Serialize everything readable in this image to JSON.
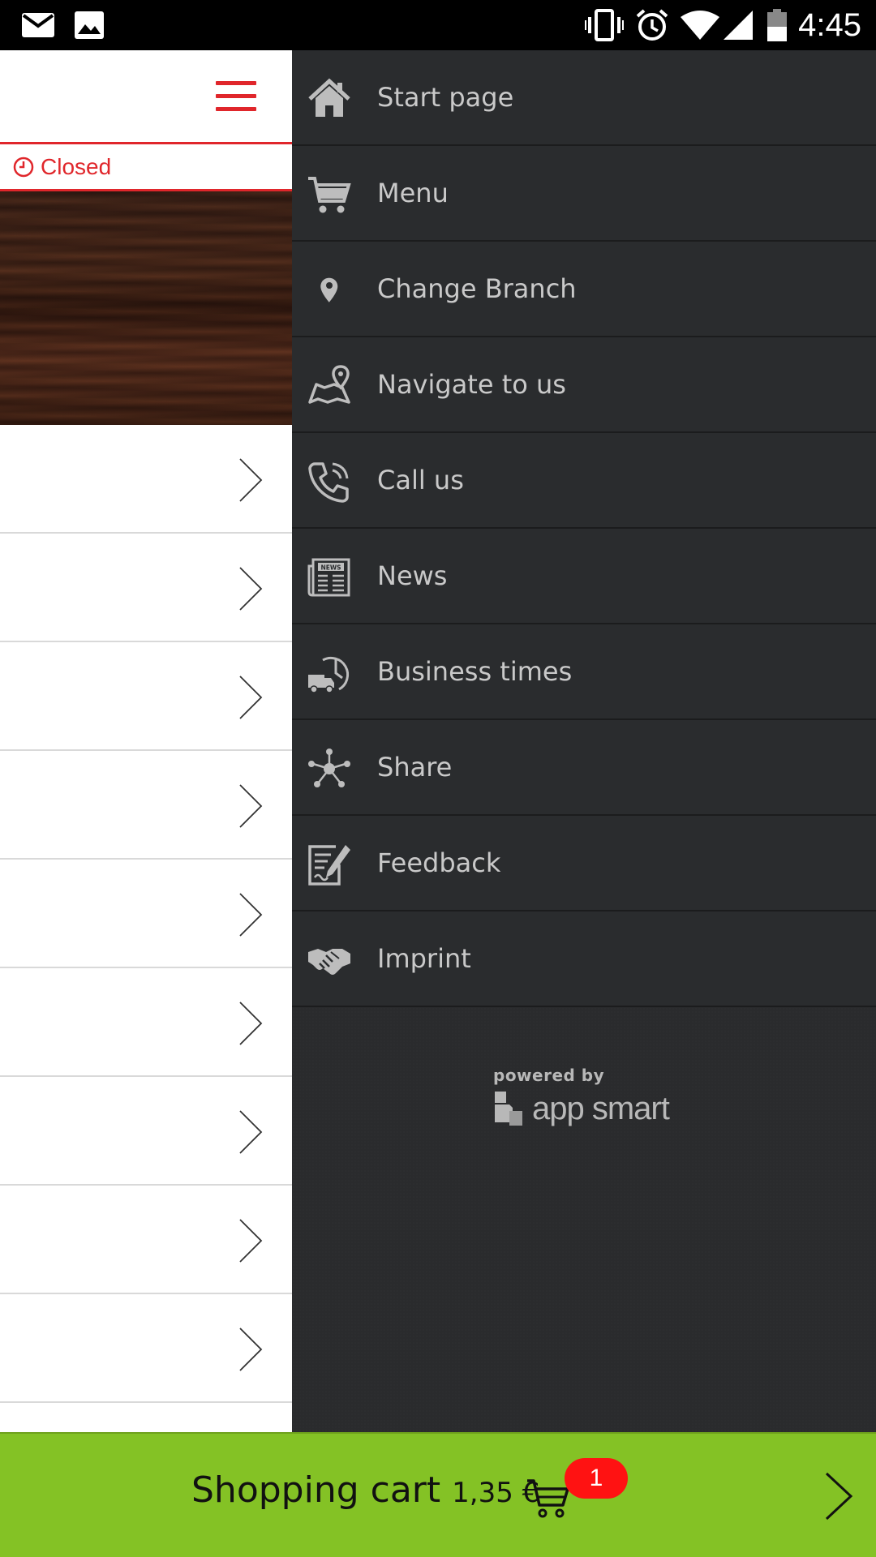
{
  "status_bar": {
    "time": "4:45",
    "icons": [
      "gmail-icon",
      "image-icon",
      "vibrate-icon",
      "alarm-icon",
      "wifi-icon",
      "signal-icon",
      "battery-icon"
    ]
  },
  "page": {
    "menu_icon": "hamburger-icon",
    "status_text": "Closed",
    "list_rows": 9
  },
  "drawer": {
    "items": [
      {
        "label": "Start page",
        "icon": "home-icon"
      },
      {
        "label": "Menu",
        "icon": "cart-icon"
      },
      {
        "label": "Change Branch",
        "icon": "location-pin-icon"
      },
      {
        "label": "Navigate to us",
        "icon": "map-icon"
      },
      {
        "label": "Call us",
        "icon": "phone-icon"
      },
      {
        "label": "News",
        "icon": "newspaper-icon"
      },
      {
        "label": "Business times",
        "icon": "delivery-clock-icon"
      },
      {
        "label": "Share",
        "icon": "share-icon"
      },
      {
        "label": "Feedback",
        "icon": "feedback-icon"
      },
      {
        "label": "Imprint",
        "icon": "handshake-icon"
      }
    ],
    "powered_by": "powered by",
    "brand": "app smart"
  },
  "cart": {
    "label": "Shopping cart",
    "price": "1,35 €",
    "count": "1"
  },
  "colors": {
    "accent_red": "#e0262b",
    "drawer_bg": "#2a2c2e",
    "cart_green": "#84c225",
    "badge_red": "#ff1212"
  }
}
